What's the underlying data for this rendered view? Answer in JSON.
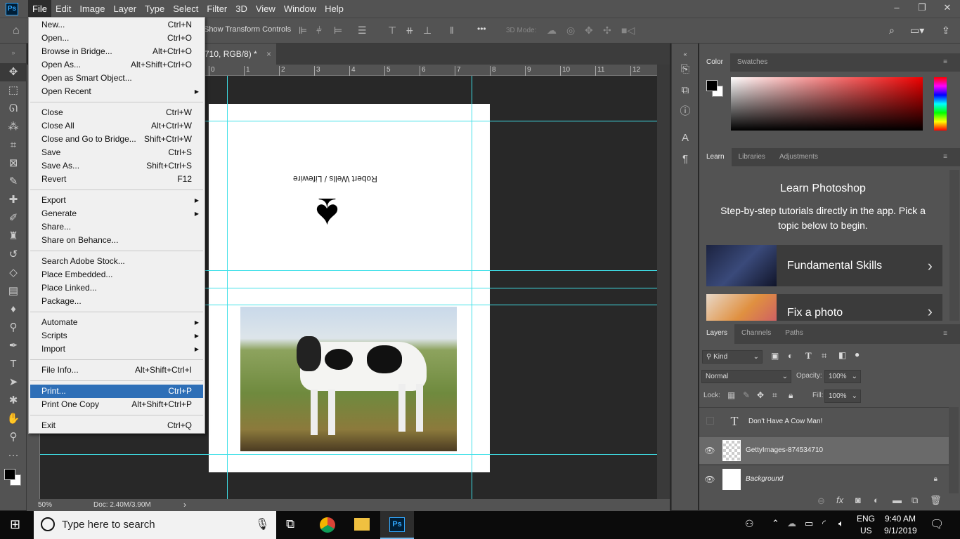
{
  "app": {
    "logo": "Ps",
    "menus": [
      "File",
      "Edit",
      "Image",
      "Layer",
      "Type",
      "Select",
      "Filter",
      "3D",
      "View",
      "Window",
      "Help"
    ],
    "window_controls": [
      "–",
      "❐",
      "✕"
    ]
  },
  "options_bar": {
    "transform_controls": "Show Transform Controls",
    "more": "•••",
    "mode_3d": "3D Mode:"
  },
  "document_tab": {
    "title": "710, RGB/8) *",
    "close": "×"
  },
  "ruler": {
    "top": [
      "0",
      "1",
      "2",
      "3",
      "4",
      "5",
      "6",
      "7",
      "8",
      "9",
      "10",
      "11",
      "12"
    ]
  },
  "canvas": {
    "credit_text": "Robert Wells / Lifewire",
    "spade": "♠"
  },
  "status": {
    "zoom": "50%",
    "doc": "Doc: 2.40M/3.90M"
  },
  "file_menu": {
    "groups": [
      [
        {
          "label": "New...",
          "shortcut": "Ctrl+N"
        },
        {
          "label": "Open...",
          "shortcut": "Ctrl+O"
        },
        {
          "label": "Browse in Bridge...",
          "shortcut": "Alt+Ctrl+O"
        },
        {
          "label": "Open As...",
          "shortcut": "Alt+Shift+Ctrl+O"
        },
        {
          "label": "Open as Smart Object...",
          "shortcut": ""
        },
        {
          "label": "Open Recent",
          "shortcut": "",
          "submenu": true
        }
      ],
      [
        {
          "label": "Close",
          "shortcut": "Ctrl+W"
        },
        {
          "label": "Close All",
          "shortcut": "Alt+Ctrl+W"
        },
        {
          "label": "Close and Go to Bridge...",
          "shortcut": "Shift+Ctrl+W"
        },
        {
          "label": "Save",
          "shortcut": "Ctrl+S"
        },
        {
          "label": "Save As...",
          "shortcut": "Shift+Ctrl+S"
        },
        {
          "label": "Revert",
          "shortcut": "F12"
        }
      ],
      [
        {
          "label": "Export",
          "shortcut": "",
          "submenu": true
        },
        {
          "label": "Generate",
          "shortcut": "",
          "submenu": true
        },
        {
          "label": "Share...",
          "shortcut": ""
        },
        {
          "label": "Share on Behance...",
          "shortcut": ""
        }
      ],
      [
        {
          "label": "Search Adobe Stock...",
          "shortcut": ""
        },
        {
          "label": "Place Embedded...",
          "shortcut": ""
        },
        {
          "label": "Place Linked...",
          "shortcut": ""
        },
        {
          "label": "Package...",
          "shortcut": ""
        }
      ],
      [
        {
          "label": "Automate",
          "shortcut": "",
          "submenu": true
        },
        {
          "label": "Scripts",
          "shortcut": "",
          "submenu": true
        },
        {
          "label": "Import",
          "shortcut": "",
          "submenu": true
        }
      ],
      [
        {
          "label": "File Info...",
          "shortcut": "Alt+Shift+Ctrl+I"
        }
      ],
      [
        {
          "label": "Print...",
          "shortcut": "Ctrl+P",
          "highlighted": true
        },
        {
          "label": "Print One Copy",
          "shortcut": "Alt+Shift+Ctrl+P"
        }
      ],
      [
        {
          "label": "Exit",
          "shortcut": "Ctrl+Q"
        }
      ]
    ]
  },
  "color_panel": {
    "tabs": [
      "Color",
      "Swatches"
    ]
  },
  "learn_panel": {
    "tabs": [
      "Learn",
      "Libraries",
      "Adjustments"
    ],
    "title": "Learn Photoshop",
    "subtitle": "Step-by-step tutorials directly in the app. Pick a topic below to begin.",
    "cards": [
      "Fundamental Skills",
      "Fix a photo"
    ]
  },
  "layers_panel": {
    "tabs": [
      "Layers",
      "Channels",
      "Paths"
    ],
    "filter": "Kind",
    "blend_mode": "Normal",
    "opacity_label": "Opacity:",
    "opacity": "100%",
    "lock_label": "Lock:",
    "fill_label": "Fill:",
    "fill": "100%",
    "layers": [
      {
        "name": "Don't Have A Cow Man!",
        "type": "text",
        "visible": false
      },
      {
        "name": "GettyImages-874534710",
        "type": "smart-object",
        "visible": true,
        "selected": true
      },
      {
        "name": "Background",
        "type": "background",
        "visible": true,
        "locked": true
      }
    ]
  },
  "taskbar": {
    "search_placeholder": "Type here to search",
    "lang1": "ENG",
    "lang2": "US",
    "time": "9:40 AM",
    "date": "9/1/2019"
  },
  "colors": {
    "guide": "#3fe0e8",
    "menu_highlight": "#2e6fb7",
    "ps_blue": "#31a8ff"
  }
}
